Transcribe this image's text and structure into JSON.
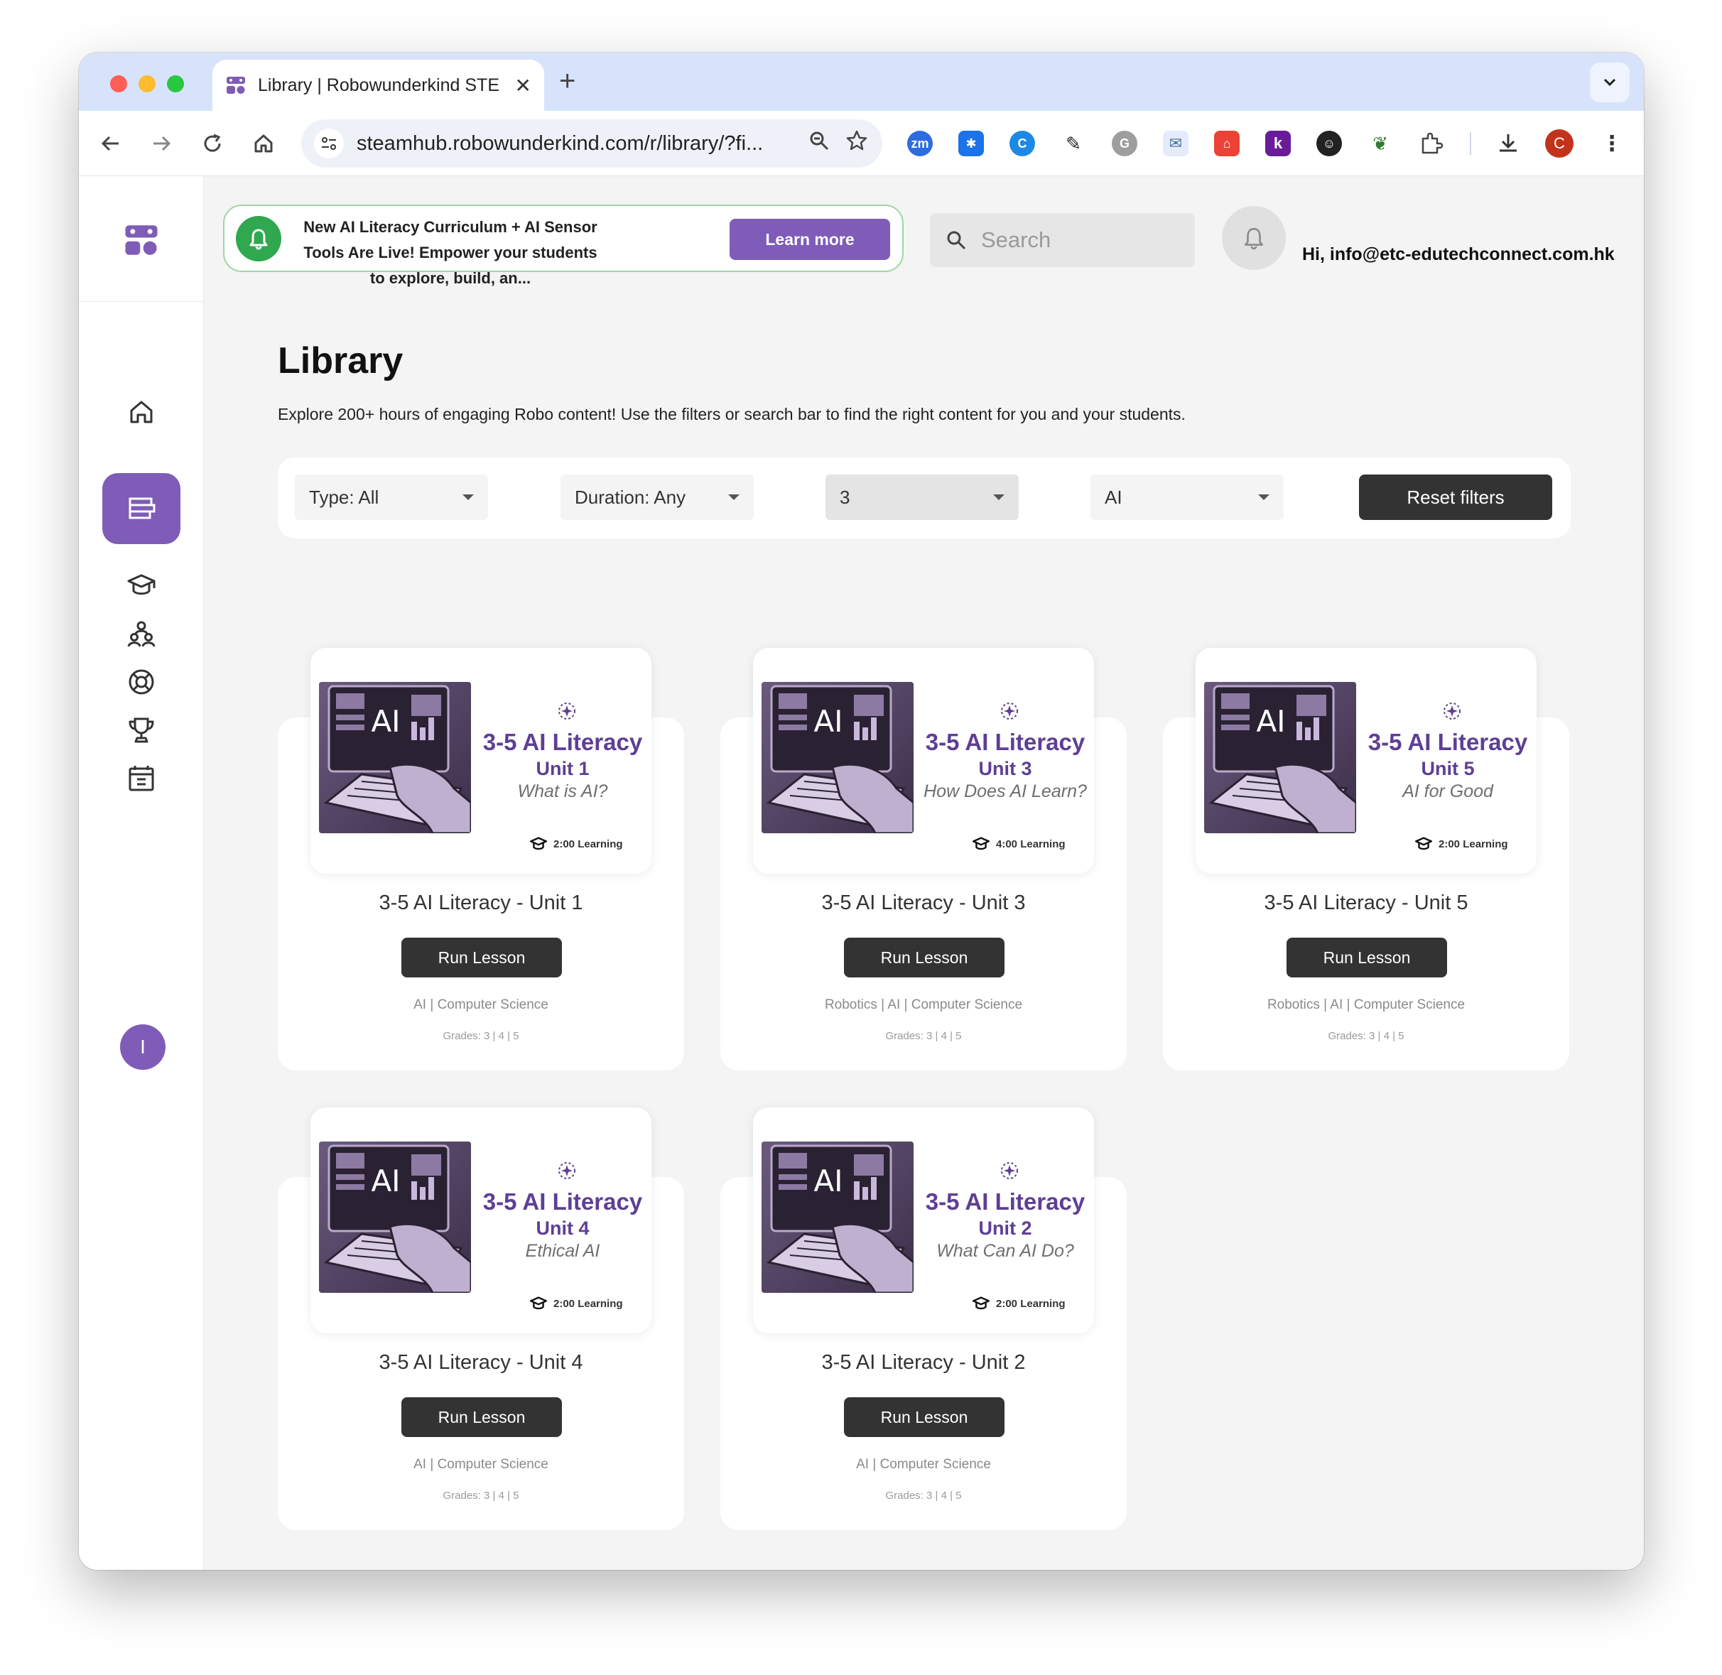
{
  "browser": {
    "tab_title": "Library | Robowunderkind STE",
    "url": "steamhub.robowunderkind.com/r/library/?fi...",
    "profile_initial": "C",
    "extensions": [
      "zm",
      "✱",
      "C",
      "✎",
      "G",
      "✉",
      "⌂",
      "k",
      "☺",
      "❦"
    ]
  },
  "banner": {
    "text": "New AI Literacy Curriculum + AI Sensor Tools Are Live! Empower your students to explore, build, an...",
    "button": "Learn more"
  },
  "search": {
    "placeholder": "Search"
  },
  "user": {
    "greeting": "Hi, info@etc-edutechconnect.com.hk",
    "avatar_initial": "I"
  },
  "page": {
    "title": "Library",
    "subtitle": "Explore 200+ hours of engaging Robo content! Use the filters or search bar to find the right content for you and your students."
  },
  "filters": {
    "type": "Type: All",
    "duration": "Duration: Any",
    "grade": "3",
    "subject": "AI",
    "reset": "Reset filters"
  },
  "cards": [
    {
      "thumb_title": "3-5 AI Literacy",
      "unit": "Unit 1",
      "topic": "What is AI?",
      "duration": "2:00 Learning",
      "img_label": "AI",
      "name": "3-5 AI Literacy - Unit 1",
      "button": "Run Lesson",
      "tags": "AI | Computer Science",
      "grades": "Grades: 3 | 4 | 5"
    },
    {
      "thumb_title": "3-5 AI Literacy",
      "unit": "Unit 3",
      "topic": "How Does AI Learn?",
      "duration": "4:00 Learning",
      "img_label": "AI",
      "name": "3-5 AI Literacy - Unit 3",
      "button": "Run Lesson",
      "tags": "Robotics | AI | Computer Science",
      "grades": "Grades: 3 | 4 | 5"
    },
    {
      "thumb_title": "3-5 AI Literacy",
      "unit": "Unit 5",
      "topic": "AI for Good",
      "duration": "2:00 Learning",
      "img_label": "AI",
      "name": "3-5 AI Literacy - Unit 5",
      "button": "Run Lesson",
      "tags": "Robotics | AI | Computer Science",
      "grades": "Grades: 3 | 4 | 5"
    },
    {
      "thumb_title": "3-5 AI Literacy",
      "unit": "Unit 4",
      "topic": "Ethical AI",
      "duration": "2:00 Learning",
      "img_label": "AI",
      "name": "3-5 AI Literacy - Unit 4",
      "button": "Run Lesson",
      "tags": "AI | Computer Science",
      "grades": "Grades: 3 | 4 | 5"
    },
    {
      "thumb_title": "3-5 AI Literacy",
      "unit": "Unit 2",
      "topic": "What Can AI Do?",
      "duration": "2:00 Learning",
      "img_label": "AI",
      "name": "3-5 AI Literacy - Unit 2",
      "button": "Run Lesson",
      "tags": "AI | Computer Science",
      "grades": "Grades: 3 | 4 | 5"
    }
  ],
  "colors": {
    "accent": "#7e5cb8",
    "title_purple": "#5e3f94",
    "dark_button": "#333333",
    "bell_green": "#2fa84f"
  }
}
